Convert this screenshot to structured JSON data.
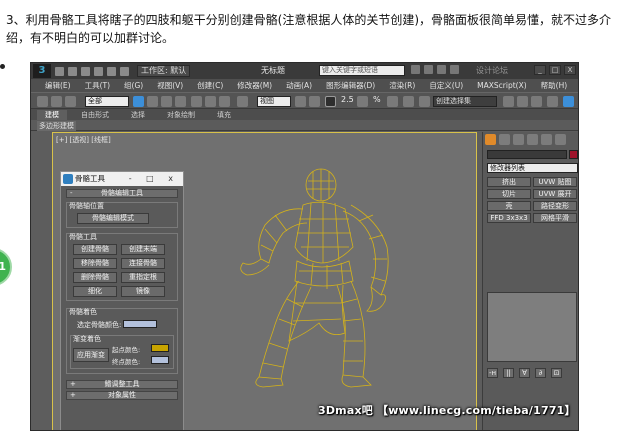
{
  "intro_text": "3、利用骨骼工具将瞎子的四肢和躯干分别创建骨骼(注意根据人体的关节创建)，骨骼面板很简单易懂，就不过多介绍，有不明白的可以加群讨论。",
  "badge_text": "1",
  "app": {
    "logo": "3",
    "workspace_label": "工作区: 默认",
    "title": "无标题",
    "search_placeholder": "键入关键字或短语",
    "watermark_small": "设计论坛",
    "win_buttons": [
      "_",
      "□",
      "X"
    ],
    "menu": [
      "编辑(E)",
      "工具(T)",
      "组(G)",
      "视图(V)",
      "创建(C)",
      "修改器(M)",
      "动画(A)",
      "图形编辑器(D)",
      "渲染(R)",
      "自定义(U)",
      "MAXScript(X)",
      "帮助(H)"
    ],
    "toolbar": {
      "selection_filter": "全部",
      "view_dropdown": "视图",
      "snap_number": "2.5",
      "angle_number": "%",
      "selection_set": "创建选择集"
    },
    "ribbon_tabs": [
      "建模",
      "自由形式",
      "选择",
      "对象绘制",
      "填充"
    ],
    "ribbon_sub": "多边形建模",
    "viewport_label": "[+] [透视] [线框]",
    "bone_tools": {
      "title": "骨骼工具",
      "controls": "- □ x",
      "rollout_edit": "骨骼编辑工具",
      "grp_bone_pivot": "骨骼轴位置",
      "btn_edit_mode": "骨骼编辑模式",
      "grp_bone_tools": "骨骼工具",
      "buttons": [
        "创建骨骼",
        "创建末端",
        "移除骨骼",
        "连接骨骼",
        "删除骨骼",
        "重指定根",
        "细化",
        "镜像"
      ],
      "grp_bone_color": "骨骼着色",
      "sel_color_label": "选定骨骼颜色:",
      "grp_gradient": "渐变着色",
      "apply_gradient": "应用渐变",
      "start_color": "起点颜色:",
      "end_color": "终点颜色:",
      "rollout_fin": "鳍调整工具",
      "rollout_obj": "对象属性"
    },
    "cmd_panel": {
      "modifier_list": "修改器列表",
      "mod_buttons": [
        "挤出",
        "UVW 贴图",
        "切片",
        "UVW 展开",
        "壳",
        "路径变形",
        "FFD 3x3x3",
        "网格平滑"
      ],
      "stack_tools": [
        "-н",
        "||",
        "∀",
        "∂",
        "⊡"
      ]
    }
  },
  "watermark": "3Dmax吧 【www.linecg.com/tieba/1771】",
  "colors": {
    "wire": "#d4b21a",
    "sel_bone_color": "#b3c1dc",
    "start_color": "#c8a400",
    "end_color": "#b3c1dc"
  }
}
